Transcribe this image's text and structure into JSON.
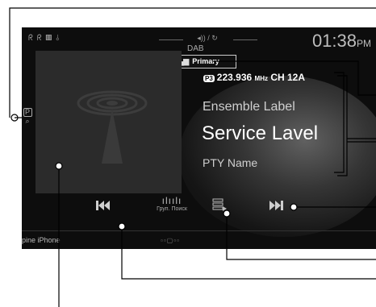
{
  "status": {
    "left_icons": "ᖇ ᖇ ▥ ⫰",
    "center_icons": "◂)) / ↻",
    "clock": "01:38",
    "clock_suffix": "PM"
  },
  "source": {
    "label": "DAB"
  },
  "signal": {
    "bars": "▂▄▆",
    "label": "Primary"
  },
  "tuning": {
    "pty_badge": "P3",
    "frequency": "223.936",
    "unit": "MHz",
    "channel": "CH 12A"
  },
  "labels": {
    "ensemble": "Ensemble Label",
    "service": "Service Lavel",
    "pty": "PTY Name"
  },
  "side": {
    "preset_badge": "P",
    "search_glyph": "⌕"
  },
  "controls": {
    "group_search_label": "Груп. Поиск"
  },
  "bottom": {
    "device_label": "Alpine iPhone",
    "page_dots": "▫▫▢▫▫"
  },
  "colors": {
    "screen_bg": "#0d0d0d",
    "text_primary": "#ffffff",
    "text_secondary": "#cfcfcf",
    "callout": "#000000"
  }
}
